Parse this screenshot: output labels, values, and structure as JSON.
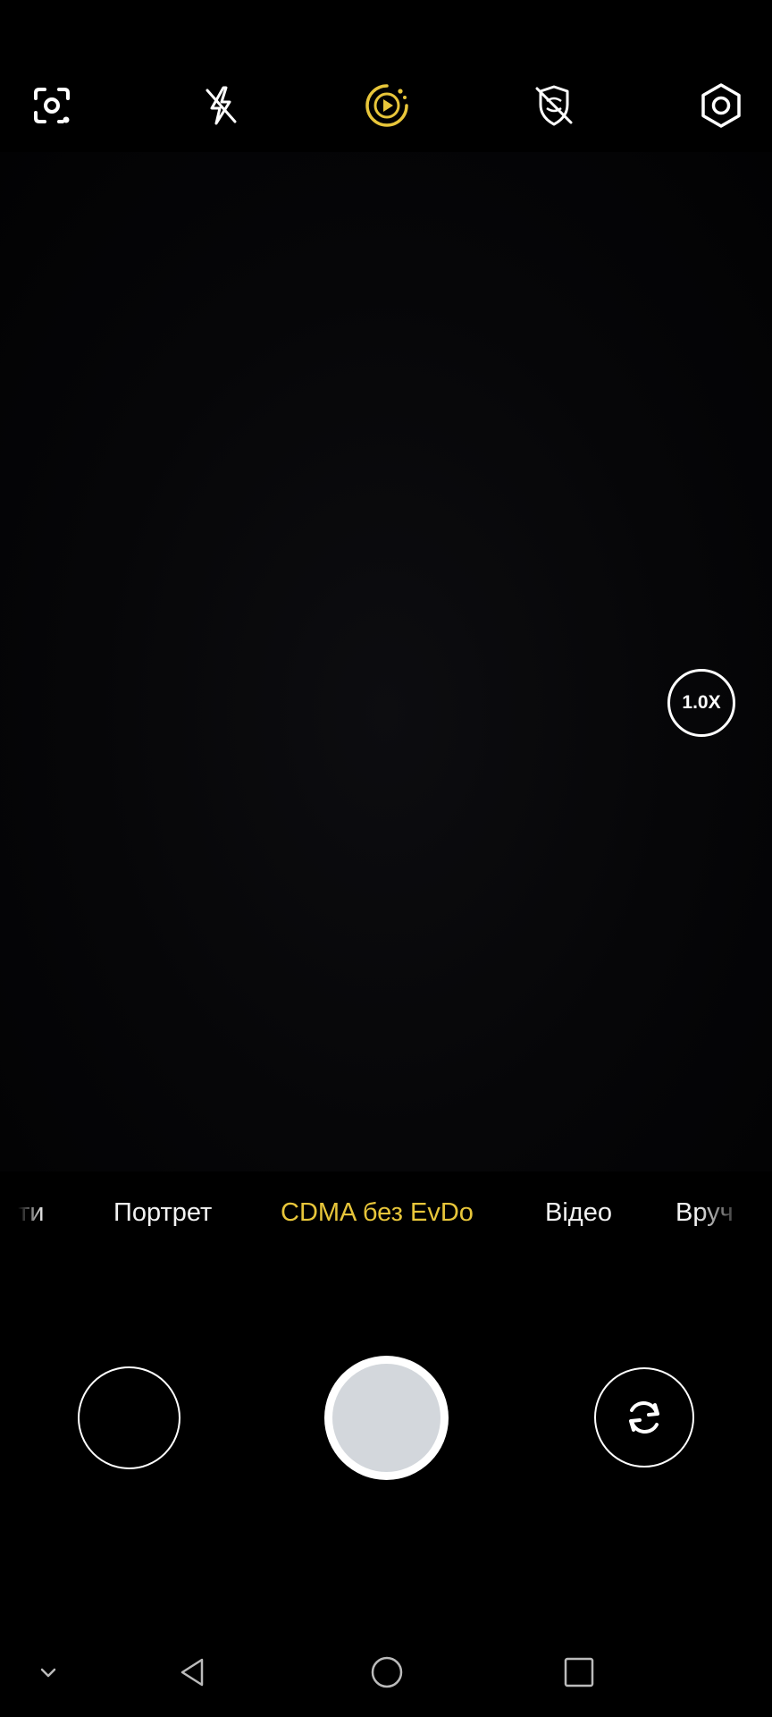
{
  "top_bar": {
    "icons": [
      "lens-scan-icon",
      "flash-off-icon",
      "motion-photo-icon",
      "ai-scene-off-icon",
      "settings-icon"
    ],
    "active_color": "#e8c63a"
  },
  "zoom": {
    "label": "1.0X"
  },
  "modes": {
    "items": [
      {
        "label": "ти"
      },
      {
        "label": "Портрет"
      },
      {
        "label": "CDMA без EvDo"
      },
      {
        "label": "Відео"
      },
      {
        "label": "Вруч"
      }
    ],
    "selected": "CDMA без EvDo",
    "accent": "#e8c63a"
  },
  "controls": {
    "gallery": "gallery-thumbnail",
    "shutter": "shutter-button",
    "switch": "switch-camera-icon"
  },
  "nav": {
    "icons": [
      "chevron-down-icon",
      "back-icon",
      "home-icon",
      "recents-icon"
    ]
  }
}
